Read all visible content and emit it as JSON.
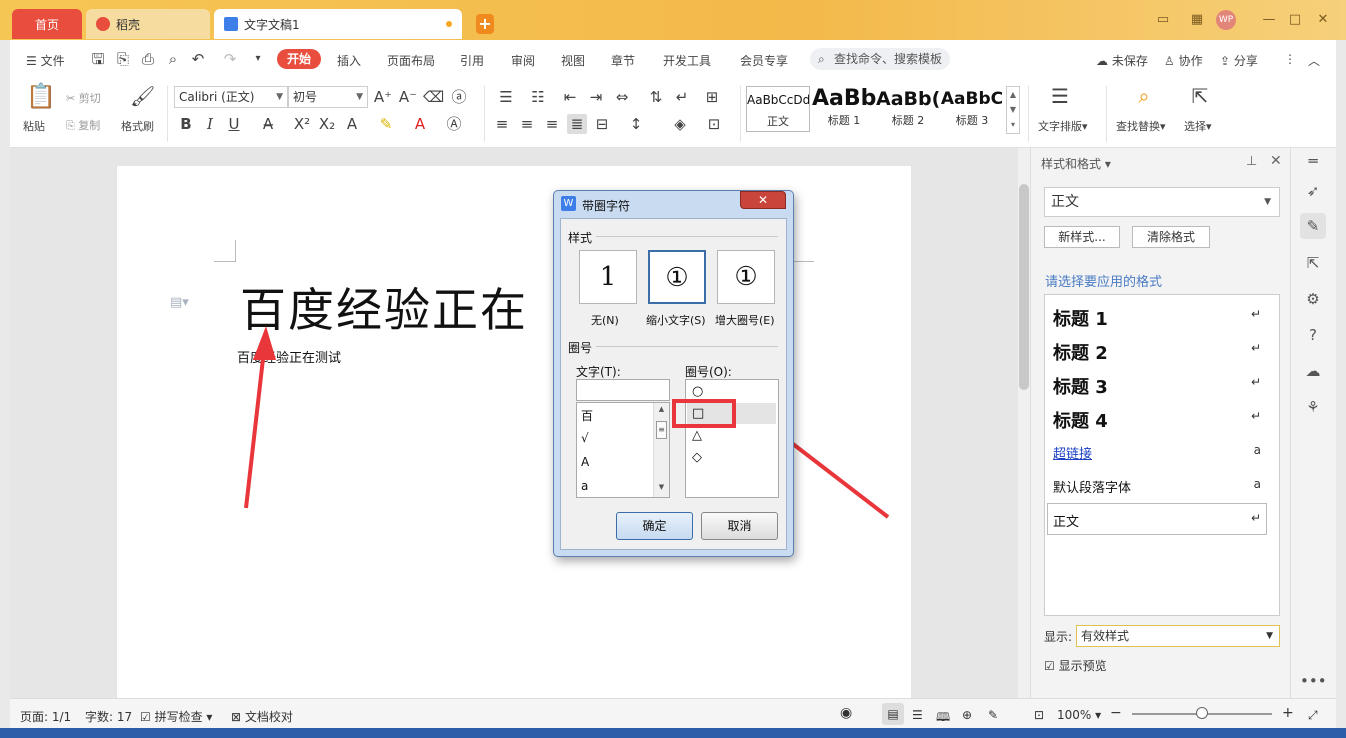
{
  "tabs": {
    "home": "首页",
    "daoke": "稻壳",
    "doc": "文字文稿1",
    "new": "+"
  },
  "menubar": {
    "file": "文件",
    "items": [
      "开始",
      "插入",
      "页面布局",
      "引用",
      "审阅",
      "视图",
      "章节",
      "开发工具",
      "会员专享"
    ],
    "search": "查找命令、搜索模板",
    "unsaved": "未保存",
    "collab": "协作",
    "share": "分享"
  },
  "ribbon": {
    "paste": "粘贴",
    "cut": "剪切",
    "copy": "复制",
    "format_painter": "格式刷",
    "font": "Calibri (正文)",
    "size": "初号",
    "styles": [
      {
        "sample": "AaBbCcDd",
        "name": "正文"
      },
      {
        "sample": "AaBb",
        "name": "标题 1"
      },
      {
        "sample": "AaBb(",
        "name": "标题 2"
      },
      {
        "sample": "AaBbC",
        "name": "标题 3"
      }
    ],
    "text_layout": "文字排版",
    "find_replace": "查找替换",
    "select": "选择"
  },
  "document": {
    "title": "百度经验正在",
    "body": "百度经验正在测试"
  },
  "panel": {
    "title": "样式和格式",
    "current": "正文",
    "new_style": "新样式...",
    "clear_format": "清除格式",
    "hint": "请选择要应用的格式",
    "styles": [
      {
        "name": "标题 1",
        "kind": "heading"
      },
      {
        "name": "标题 2",
        "kind": "heading"
      },
      {
        "name": "标题 3",
        "kind": "heading"
      },
      {
        "name": "标题 4",
        "kind": "heading"
      },
      {
        "name": "超链接",
        "kind": "link"
      },
      {
        "name": "默认段落字体",
        "kind": "plain"
      },
      {
        "name": "正文",
        "kind": "plain"
      }
    ],
    "show_label": "显示:",
    "show_value": "有效样式",
    "preview_label": "显示预览"
  },
  "dialog": {
    "title": "带圈字符",
    "style_section": "样式",
    "options": [
      {
        "glyph": "1",
        "label": "无(N)"
      },
      {
        "glyph": "①",
        "label": "缩小文字(S)"
      },
      {
        "glyph": "①",
        "label": "增大圈号(E)"
      }
    ],
    "circle_section": "圈号",
    "text_label": "文字(T):",
    "circle_label": "圈号(O):",
    "text_items": [
      "百",
      "√",
      "A",
      "a"
    ],
    "circle_items": [
      "○",
      "□",
      "△",
      "◇"
    ],
    "ok": "确定",
    "cancel": "取消"
  },
  "status": {
    "page": "页面: 1/1",
    "words": "字数: 17",
    "spell": "拼写检查",
    "proof": "文档校对",
    "zoom": "100%"
  },
  "colors": {
    "accent": "#e84d3d",
    "title_bar": "#f4c04a",
    "highlight": "#e8363b"
  }
}
